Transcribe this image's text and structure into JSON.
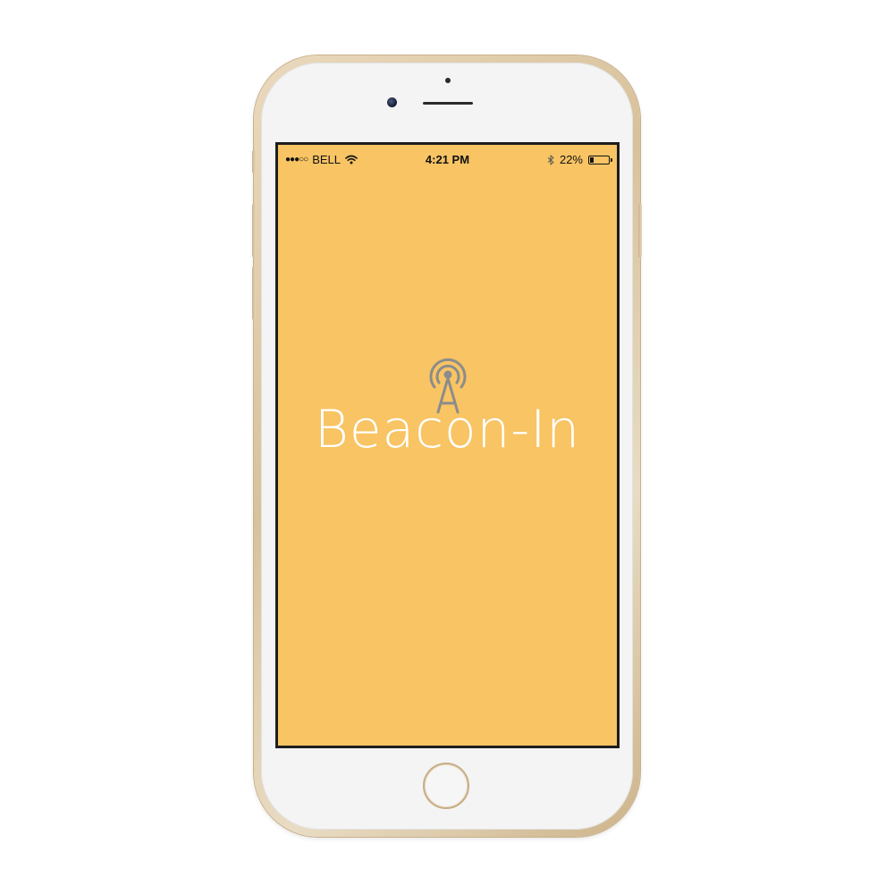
{
  "status_bar": {
    "signal": "●●●○○",
    "carrier": "BELL",
    "time": "4:21 PM",
    "battery_percent_label": "22%",
    "battery_level": 0.22,
    "icons": {
      "wifi": "wifi-icon",
      "bluetooth": "bluetooth-icon",
      "battery": "battery-icon"
    }
  },
  "app": {
    "name": "Beacon-In",
    "logo_icon": "beacon-antenna-icon"
  },
  "colors": {
    "screen_background": "#f8c464",
    "app_name": "#ffffff",
    "logo": "#8c8c8c",
    "phone_gold": "#d8c29c"
  }
}
